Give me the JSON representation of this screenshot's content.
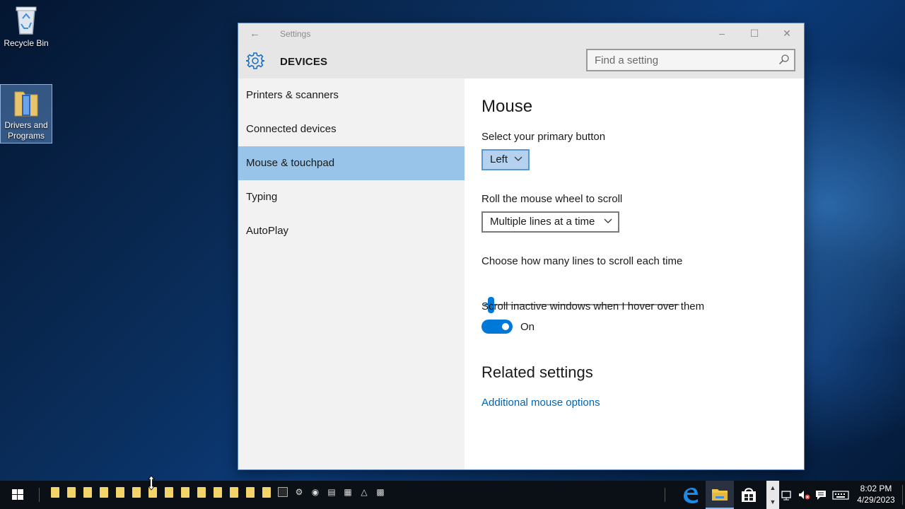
{
  "desktop": {
    "icons": [
      {
        "label": "Recycle Bin"
      },
      {
        "label": "Drivers and Programs"
      }
    ]
  },
  "window": {
    "title": "Settings",
    "section": "DEVICES",
    "search": {
      "placeholder": "Find a setting",
      "value": ""
    },
    "nav": [
      {
        "label": "Printers & scanners",
        "active": false
      },
      {
        "label": "Connected devices",
        "active": false
      },
      {
        "label": "Mouse & touchpad",
        "active": true
      },
      {
        "label": "Typing",
        "active": false
      },
      {
        "label": "AutoPlay",
        "active": false
      }
    ],
    "content": {
      "heading": "Mouse",
      "primary_button": {
        "label": "Select your primary button",
        "value": "Left"
      },
      "wheel_scroll": {
        "label": "Roll the mouse wheel to scroll",
        "value": "Multiple lines at a time"
      },
      "lines_slider": {
        "label": "Choose how many lines to scroll each time",
        "value_fraction": 0.02
      },
      "inactive_scroll": {
        "label": "Scroll inactive windows when I hover over them",
        "state": "On",
        "on": true
      },
      "related_heading": "Related settings",
      "related_link": "Additional mouse options"
    }
  },
  "taskbar": {
    "time": "8:02 PM",
    "date": "4/29/2023",
    "pinned": [
      "edge-icon",
      "file-explorer-icon",
      "store-icon"
    ],
    "tray": [
      "network-icon",
      "volume-muted-icon",
      "action-center-icon",
      "keyboard-icon"
    ]
  },
  "colors": {
    "accent": "#0078d7",
    "nav_active": "#97c4e8",
    "link": "#0063b1",
    "titlebar": "#e6e6e6"
  }
}
